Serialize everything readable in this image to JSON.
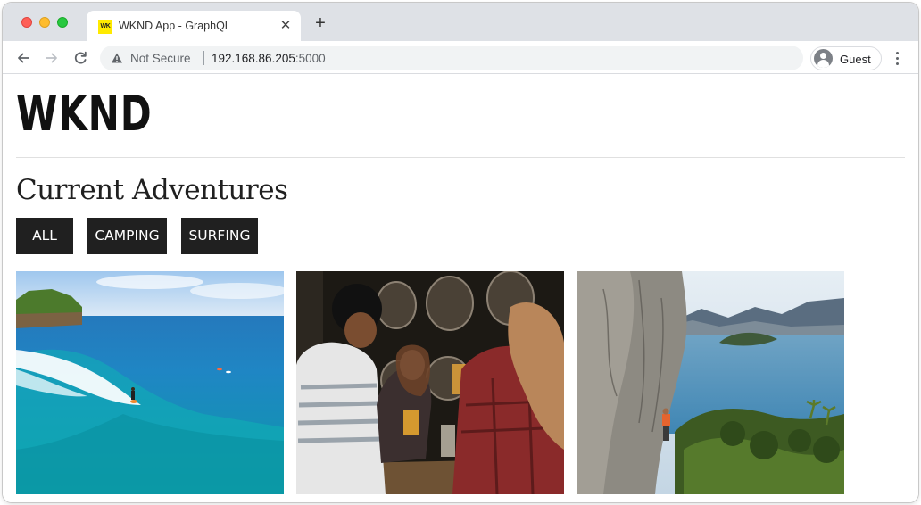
{
  "browser": {
    "tab_title": "WKND App - GraphQL",
    "favicon_text": "WK",
    "close_glyph": "✕",
    "new_tab_glyph": "+",
    "security_label": "Not Secure",
    "url_host": "192.168.86.205",
    "url_port": ":5000",
    "profile_label": "Guest",
    "icons": [
      "back-arrow-icon",
      "forward-arrow-icon",
      "reload-icon",
      "warning-triangle-icon",
      "avatar-icon",
      "kebab-menu-icon"
    ],
    "traffic_light_colors": {
      "close": "#fe5f57",
      "minimize": "#febc2e",
      "zoom": "#28c840"
    }
  },
  "page": {
    "logo": "WKND",
    "heading": "Current Adventures",
    "filters": [
      {
        "label": "ALL"
      },
      {
        "label": "CAMPING"
      },
      {
        "label": "SURFING"
      }
    ],
    "button_color": "#202020",
    "cards": [
      {
        "image": "surfing-ocean-photo"
      },
      {
        "image": "friends-at-bar-photo"
      },
      {
        "image": "rock-climbing-lake-photo"
      }
    ]
  }
}
